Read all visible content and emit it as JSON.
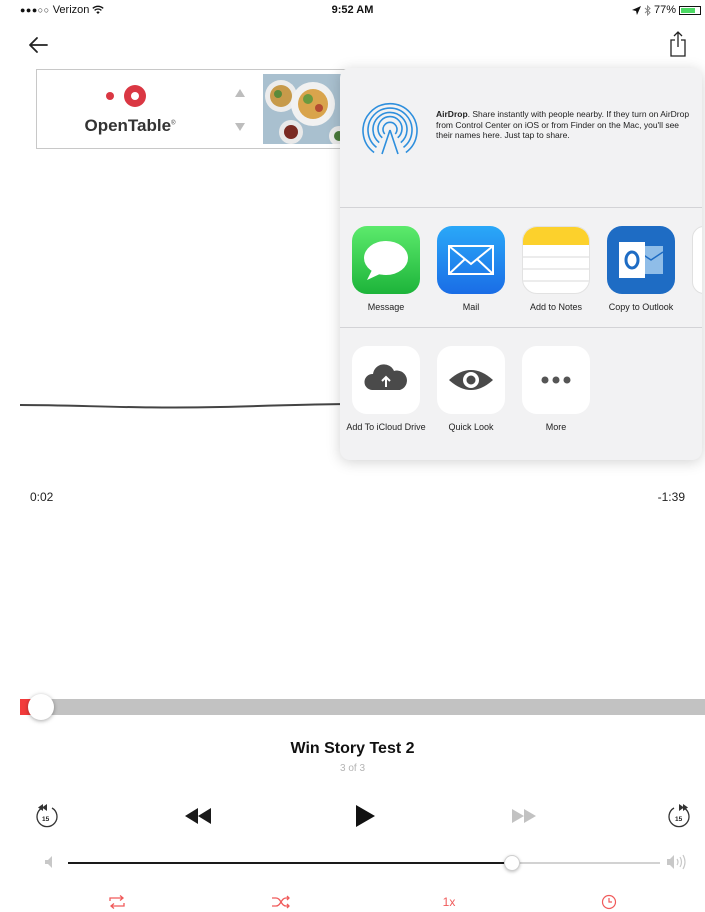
{
  "status_bar": {
    "signal": "●●●○○",
    "carrier": "Verizon",
    "time": "9:52 AM",
    "battery": "77%",
    "battery_level": 0.77
  },
  "ad": {
    "brand": "OpenTable",
    "brand_mark": "®",
    "accent_color": "#da3743"
  },
  "playback": {
    "elapsed": "0:02",
    "remaining": "-1:39",
    "progress": 0.02,
    "played_color": "#f23b3b"
  },
  "share_sheet": {
    "airdrop_title": "AirDrop",
    "airdrop_text": ". Share instantly with people nearby. If they turn on AirDrop from Control Center on iOS or from Finder on the Mac, you'll see their names here. Just tap to share.",
    "apps": [
      {
        "label": "Message",
        "icon": "message-bubble-icon"
      },
      {
        "label": "Mail",
        "icon": "envelope-icon"
      },
      {
        "label": "Add to Notes",
        "icon": "notes-icon"
      },
      {
        "label": "Copy to Outlook",
        "icon": "outlook-icon"
      }
    ],
    "actions": [
      {
        "label": "Add To iCloud Drive",
        "icon": "icloud-upload-icon"
      },
      {
        "label": "Quick Look",
        "icon": "eye-icon"
      },
      {
        "label": "More",
        "icon": "more-dots-icon"
      }
    ]
  },
  "track": {
    "title": "Win Story Test 2",
    "position": "3 of 3"
  },
  "controls": {
    "skip_back_seconds": "15",
    "skip_forward_seconds": "15",
    "speed": "1x",
    "volume": 0.75,
    "accent_color": "#f05a5a"
  }
}
